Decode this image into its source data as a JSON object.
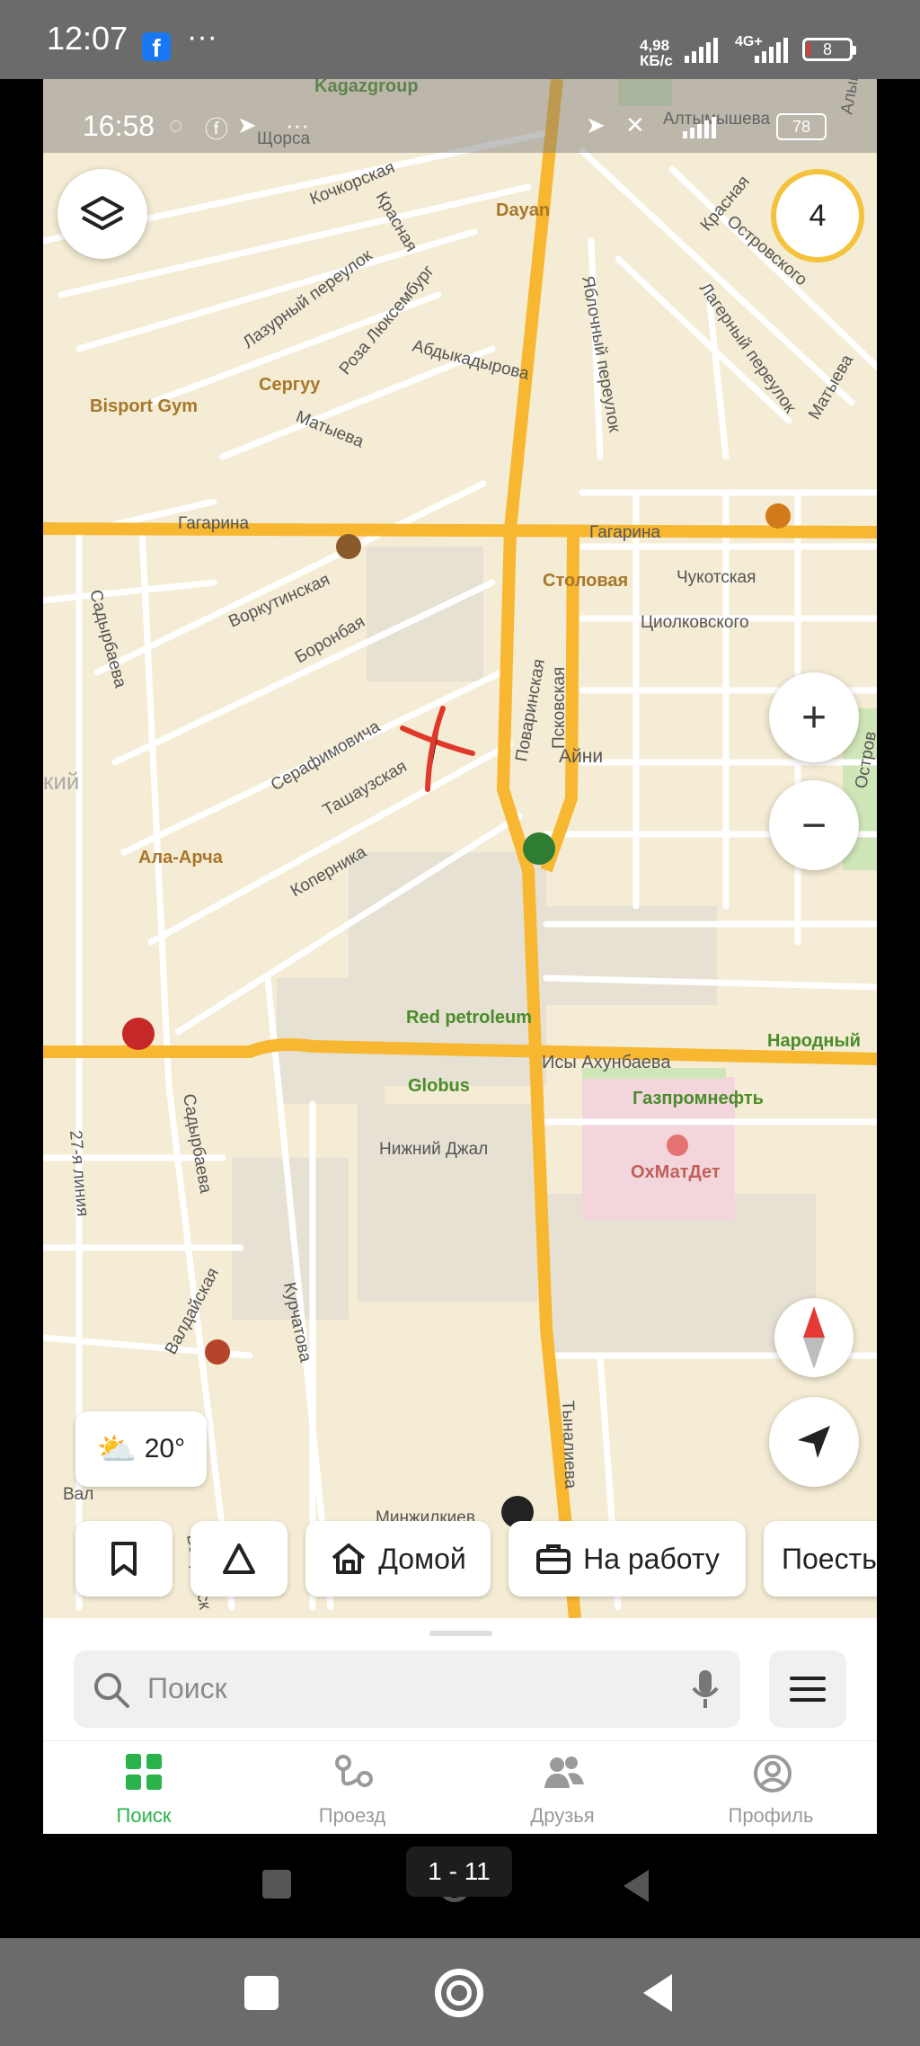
{
  "outer_status": {
    "time": "12:07",
    "dots": "···",
    "net_speed_top": "4,98",
    "net_speed_bottom": "КБ/с",
    "network_type": "4G+",
    "battery": "8"
  },
  "inner_status": {
    "time": "16:58",
    "dots": "···",
    "battery": "78"
  },
  "map": {
    "layers_button": "layers-icon",
    "badge_count": "4",
    "streets": {
      "gagarina_left": "Гагарина",
      "gagarina_right": "Гагарина",
      "vorkutinskaya": "Воркутинская",
      "boronbaya": "Боронбая",
      "serafimovicha": "Серафимовича",
      "tashauzskaya": "Ташаузская",
      "kopernika": "Коперника",
      "povarinskaya": "Поваринская",
      "pskovskaya": "Псковская",
      "aini": "Айни",
      "sadyrbaeva_top": "Садырбаева",
      "sadyrbaeva_bottom": "Садырбаева",
      "chukotskaya": "Чукотская",
      "tsiolkovskogo": "Циолковского",
      "kochkorskaya": "Кочкорская",
      "krasnaya": "Красная",
      "lazurny": "Лазурный переулок",
      "roza": "Роза Люксембург",
      "abdykadyrova": "Абдыкадырова",
      "matyeva_left": "Матыева",
      "matyeva_right": "Матыева",
      "yablochny": "Яблочный переулок",
      "lagerny": "Лагерный переулок",
      "ostrovskogo": "Островского",
      "krasnaya_right": "Красная",
      "shorsa": "Щорса",
      "isy_akhunbaeva": "Исы Ахунбаева",
      "valdaiskaya": "Валдайская",
      "kurchatova": "Курчатова",
      "tynalieva": "Тыналиева",
      "line27": "27-я линия",
      "nizhny_dzhal": "Нижний Джал",
      "minzhilkiev": "Минжилкиев",
      "altymysheva": "Алтымышева",
      "alykul": "Алыкул",
      "valdai_short": "Вал",
      "valdai_bottom": "Валдайск",
      "ostrov_right": "Остров",
      "region_kiy": "кий",
      "kagaz": "Kagazgroup"
    },
    "pois": {
      "dayan": "Dayan",
      "bisport": "Bisport Gym",
      "serguu": "Сергуу",
      "stolovaya": "Столовая",
      "ala_archa": "Ала-Арча",
      "red_petroleum": "Red petroleum",
      "globus": "Globus",
      "narodny": "Народный",
      "gazprom": "Газпромнефть",
      "okhmatdet": "ОхМатДет"
    },
    "colors": {
      "road_major": "#f7b731",
      "road_minor": "#ffffff",
      "background": "#f4ecd4",
      "poi_green": "#4a8c2a",
      "poi_brown": "#a8772a"
    }
  },
  "controls": {
    "zoom_in": "+",
    "zoom_out": "−"
  },
  "weather": {
    "temp": "20°"
  },
  "chips": {
    "home": "Домой",
    "work": "На работу",
    "eat": "Поесть"
  },
  "search": {
    "placeholder": "Поиск"
  },
  "tabs": [
    {
      "label": "Поиск"
    },
    {
      "label": "Проезд"
    },
    {
      "label": "Друзья"
    },
    {
      "label": "Профиль"
    }
  ],
  "inner_nav": {
    "page_pill": "1 - 11"
  }
}
